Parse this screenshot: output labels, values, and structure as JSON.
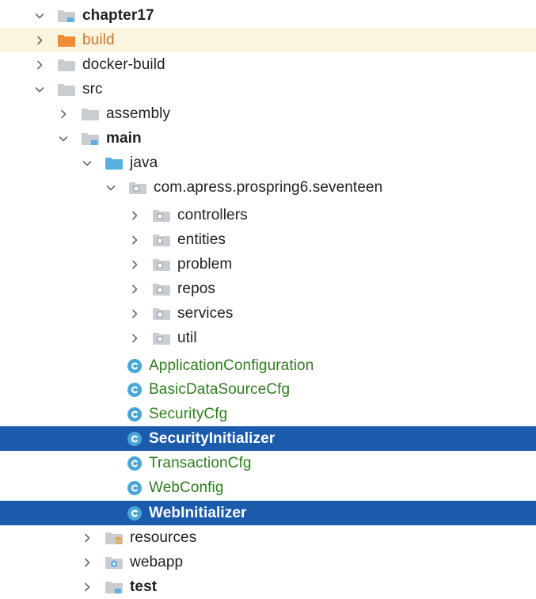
{
  "project_tree": {
    "items": [
      {
        "label": "chapter17",
        "state": "expanded",
        "icon": "module-folder-icon",
        "bold": true
      },
      {
        "label": "build",
        "state": "collapsed",
        "icon": "excluded-folder-icon",
        "highlight": "yellow"
      },
      {
        "label": "docker-build",
        "state": "collapsed",
        "icon": "folder-icon"
      },
      {
        "label": "src",
        "state": "expanded",
        "icon": "folder-icon"
      },
      {
        "label": "assembly",
        "state": "collapsed",
        "icon": "folder-icon"
      },
      {
        "label": "main",
        "state": "expanded",
        "icon": "module-folder-icon",
        "bold": true
      },
      {
        "label": "java",
        "state": "expanded",
        "icon": "source-root-icon"
      },
      {
        "label": "com.apress.prospring6.seventeen",
        "state": "expanded",
        "icon": "package-icon"
      },
      {
        "label": "controllers",
        "state": "collapsed",
        "icon": "package-icon"
      },
      {
        "label": "entities",
        "state": "collapsed",
        "icon": "package-icon"
      },
      {
        "label": "problem",
        "state": "collapsed",
        "icon": "package-icon"
      },
      {
        "label": "repos",
        "state": "collapsed",
        "icon": "package-icon"
      },
      {
        "label": "services",
        "state": "collapsed",
        "icon": "package-icon"
      },
      {
        "label": "util",
        "state": "collapsed",
        "icon": "package-icon"
      },
      {
        "label": "ApplicationConfiguration",
        "state": "leaf",
        "icon": "java-class-icon"
      },
      {
        "label": "BasicDataSourceCfg",
        "state": "leaf",
        "icon": "java-class-icon"
      },
      {
        "label": "SecurityCfg",
        "state": "leaf",
        "icon": "java-class-icon"
      },
      {
        "label": "SecurityInitializer",
        "state": "leaf",
        "icon": "java-class-icon",
        "highlight": "blue"
      },
      {
        "label": "TransactionCfg",
        "state": "leaf",
        "icon": "java-class-icon"
      },
      {
        "label": "WebConfig",
        "state": "leaf",
        "icon": "java-class-icon"
      },
      {
        "label": "WebInitializer",
        "state": "leaf",
        "icon": "java-class-icon",
        "highlight": "blue"
      },
      {
        "label": "resources",
        "state": "collapsed",
        "icon": "resources-folder-icon"
      },
      {
        "label": "webapp",
        "state": "collapsed",
        "icon": "web-folder-icon"
      },
      {
        "label": "test",
        "state": "collapsed",
        "icon": "module-folder-icon",
        "bold": true
      }
    ]
  },
  "colors": {
    "selection": "#1b5bab",
    "excluded_row": "#fbf4de",
    "folder": "#c9cdd2",
    "source_folder": "#5aaee0",
    "excluded_folder": "#f08d33",
    "class_icon": "#4aa6d8",
    "class_label": "#2f7d1f"
  }
}
